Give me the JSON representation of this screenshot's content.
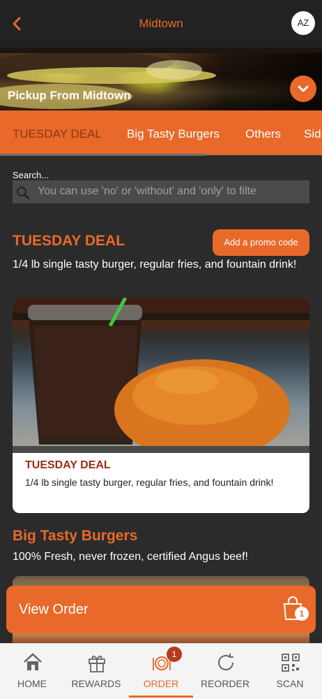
{
  "header": {
    "title": "Midtown",
    "avatar_initials": "AZ"
  },
  "hero": {
    "pickup_text": "Pickup From Midtown"
  },
  "tabs": [
    {
      "label": "TUESDAY DEAL",
      "active": true
    },
    {
      "label": "Big Tasty Burgers",
      "active": false
    },
    {
      "label": "Others",
      "active": false
    },
    {
      "label": "Sid",
      "active": false
    }
  ],
  "search": {
    "label": "Search...",
    "placeholder": "You can use 'no' or 'without' and 'only' to filte"
  },
  "sections": [
    {
      "title": "TUESDAY DEAL",
      "description": "1/4 lb single tasty burger, regular fries, and fountain drink!",
      "promo_button": "Add a promo code",
      "items": [
        {
          "title": "TUESDAY DEAL",
          "description": "1/4 lb single tasty burger, regular fries, and fountain drink!"
        }
      ]
    },
    {
      "title": "Big Tasty Burgers",
      "description": "100% Fresh, never frozen, certified Angus beef!"
    }
  ],
  "view_order": {
    "label": "View Order",
    "count": "1"
  },
  "bottom_nav": [
    {
      "label": "HOME",
      "icon": "home-icon"
    },
    {
      "label": "REWARDS",
      "icon": "gift-icon"
    },
    {
      "label": "ORDER",
      "icon": "plate-icon",
      "badge": "1",
      "active": true
    },
    {
      "label": "REORDER",
      "icon": "refresh-icon"
    },
    {
      "label": "SCAN",
      "icon": "qr-code-icon"
    }
  ],
  "colors": {
    "accent": "#e8692a",
    "background": "#2b2b2b",
    "dark_red": "#9a2e16"
  }
}
